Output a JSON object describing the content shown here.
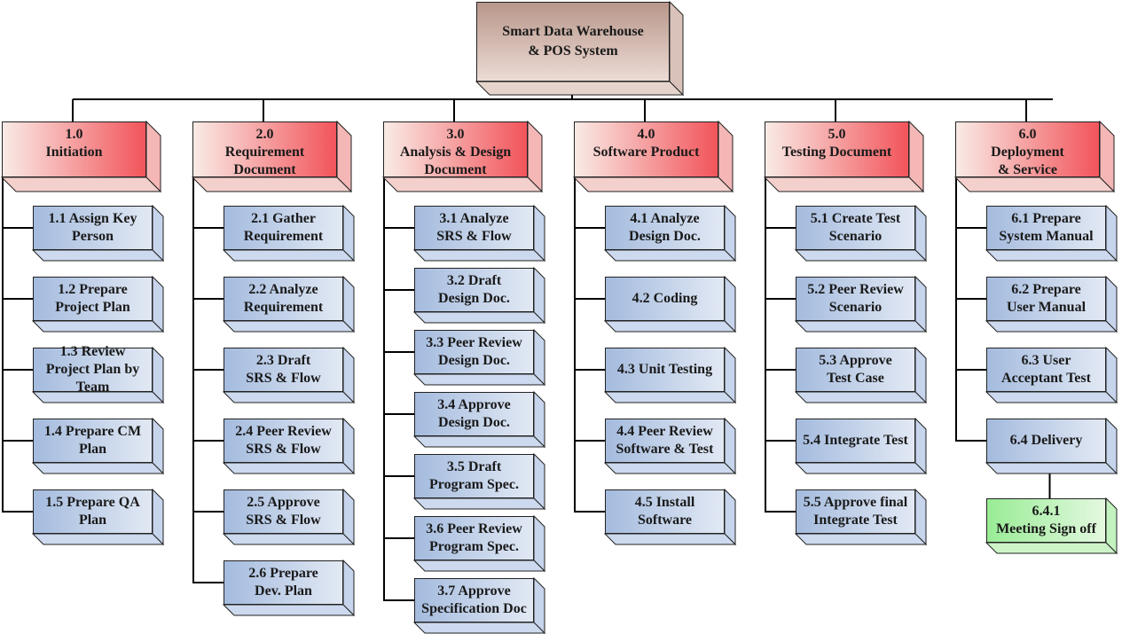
{
  "root": {
    "label": "Smart Data Warehouse\n& POS System"
  },
  "colors": {
    "header": "#f25a5e",
    "task": "#a9bfe0",
    "root": "#c8a699",
    "subtask": "#a3f0a0",
    "line": "#000000"
  },
  "columns": [
    {
      "header": "1.0\nInitiation",
      "items": [
        {
          "label": "1.1 Assign Key\nPerson"
        },
        {
          "label": "1.2 Prepare\nProject Plan"
        },
        {
          "label": "1.3 Review\nProject Plan by\nTeam"
        },
        {
          "label": "1.4 Prepare CM\nPlan"
        },
        {
          "label": "1.5 Prepare QA\nPlan"
        }
      ]
    },
    {
      "header": "2.0\nRequirement\nDocument",
      "items": [
        {
          "label": "2.1 Gather\nRequirement"
        },
        {
          "label": "2.2 Analyze\nRequirement"
        },
        {
          "label": "2.3 Draft\nSRS & Flow"
        },
        {
          "label": "2.4 Peer Review\nSRS & Flow"
        },
        {
          "label": "2.5 Approve\nSRS & Flow"
        },
        {
          "label": "2.6 Prepare\nDev. Plan"
        }
      ]
    },
    {
      "header": "3.0\nAnalysis & Design\nDocument",
      "items": [
        {
          "label": "3.1 Analyze\nSRS & Flow"
        },
        {
          "label": "3.2 Draft\nDesign Doc."
        },
        {
          "label": "3.3 Peer Review\nDesign Doc."
        },
        {
          "label": "3.4 Approve\nDesign Doc."
        },
        {
          "label": "3.5 Draft\nProgram Spec."
        },
        {
          "label": "3.6 Peer Review\nProgram Spec."
        },
        {
          "label": "3.7 Approve\nSpecification Doc"
        }
      ]
    },
    {
      "header": "4.0\nSoftware Product",
      "items": [
        {
          "label": "4.1 Analyze\nDesign Doc."
        },
        {
          "label": "4.2 Coding"
        },
        {
          "label": "4.3 Unit Testing"
        },
        {
          "label": "4.4 Peer Review\nSoftware & Test"
        },
        {
          "label": "4.5 Install\nSoftware"
        }
      ]
    },
    {
      "header": "5.0\nTesting Document",
      "items": [
        {
          "label": "5.1 Create Test\nScenario"
        },
        {
          "label": "5.2 Peer Review\nScenario"
        },
        {
          "label": "5.3 Approve\nTest Case"
        },
        {
          "label": "5.4 Integrate Test"
        },
        {
          "label": "5.5 Approve final\nIntegrate Test"
        }
      ]
    },
    {
      "header": "6.0\nDeployment\n& Service",
      "items": [
        {
          "label": "6.1 Prepare\nSystem Manual"
        },
        {
          "label": "6.2 Prepare\nUser Manual"
        },
        {
          "label": "6.3 User\nAcceptant Test"
        },
        {
          "label": "6.4 Delivery",
          "children": [
            {
              "label": "6.4.1\nMeeting Sign off"
            }
          ]
        }
      ]
    }
  ]
}
